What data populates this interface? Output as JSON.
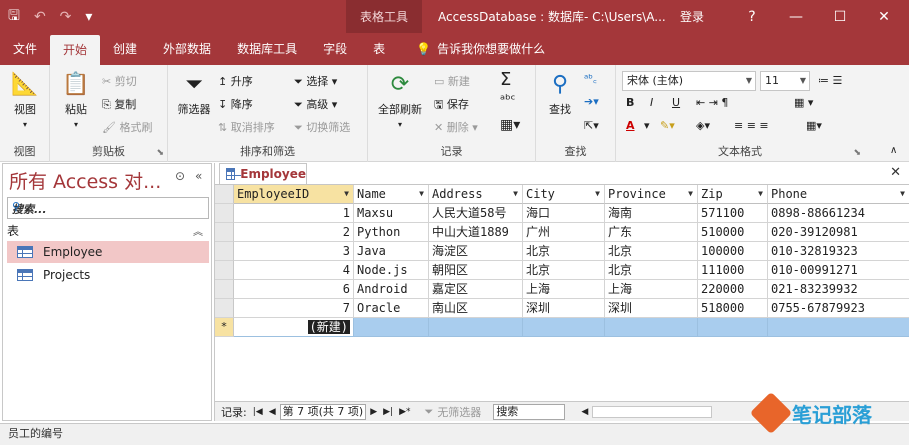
{
  "titlebar": {
    "save_icon": "save-icon",
    "undo_icon": "undo-icon",
    "redo_icon": "redo-icon",
    "customize_icon": "customize-icon",
    "context_tab": "表格工具",
    "title": "AccessDatabase : 数据库- C:\\Users\\A...",
    "login": "登录",
    "help": "?",
    "minimize": "—",
    "restore": "☐",
    "close": "✕"
  },
  "tabs": [
    {
      "label": "文件"
    },
    {
      "label": "开始",
      "active": true
    },
    {
      "label": "创建"
    },
    {
      "label": "外部数据"
    },
    {
      "label": "数据库工具"
    },
    {
      "label": "字段"
    },
    {
      "label": "表"
    }
  ],
  "tellme": "告诉我你想要做什么",
  "ribbon": {
    "views": {
      "view": "视图",
      "group": "视图"
    },
    "clipboard": {
      "paste": "粘贴",
      "cut": "剪切",
      "copy": "复制",
      "format_painter": "格式刷",
      "group": "剪贴板"
    },
    "sort_filter": {
      "filter": "筛选器",
      "asc": "升序",
      "desc": "降序",
      "remove_sort": "取消排序",
      "select": "选择",
      "advanced": "高级",
      "toggle": "切换筛选",
      "group": "排序和筛选"
    },
    "records": {
      "refresh_all": "全部刷新",
      "new": "新建",
      "save": "保存",
      "delete": "删除",
      "group": "记录"
    },
    "find": {
      "find": "查找",
      "group": "查找"
    },
    "text_format": {
      "font": "宋体 (主体)",
      "size": "11",
      "bold": "B",
      "italic": "I",
      "underline": "U",
      "font_color": "A",
      "group": "文本格式"
    }
  },
  "navpane": {
    "title": "所有 Access 对...",
    "search_placeholder": "搜索...",
    "category": "表",
    "items": [
      {
        "label": "Employee",
        "selected": true
      },
      {
        "label": "Projects"
      }
    ]
  },
  "document": {
    "tab": "Employee",
    "columns": [
      "EmployeeID",
      "Name",
      "Address",
      "City",
      "Province",
      "Zip",
      "Phone"
    ],
    "rows": [
      [
        "1",
        "Maxsu",
        "人民大道58号",
        "海口",
        "海南",
        "571100",
        "0898-88661234"
      ],
      [
        "2",
        "Python",
        "中山大道1889",
        "广州",
        "广东",
        "510000",
        "020-39120981"
      ],
      [
        "3",
        "Java",
        "海淀区",
        "北京",
        "北京",
        "100000",
        "010-32819323"
      ],
      [
        "4",
        "Node.js",
        "朝阳区",
        "北京",
        "北京",
        "111000",
        "010-00991271"
      ],
      [
        "6",
        "Android",
        "嘉定区",
        "上海",
        "上海",
        "220000",
        "021-83239932"
      ],
      [
        "7",
        "Oracle",
        "南山区",
        "深圳",
        "深圳",
        "518000",
        "0755-67879923"
      ]
    ],
    "new_row_label": "(新建)",
    "new_row_marker": "*"
  },
  "recordnav": {
    "label": "记录:",
    "position": "第 7 项(共 7 项)",
    "filter": "无筛选器",
    "search": "搜索"
  },
  "statusbar": {
    "text": "员工的编号"
  },
  "watermark": {
    "text": "笔记部落"
  }
}
